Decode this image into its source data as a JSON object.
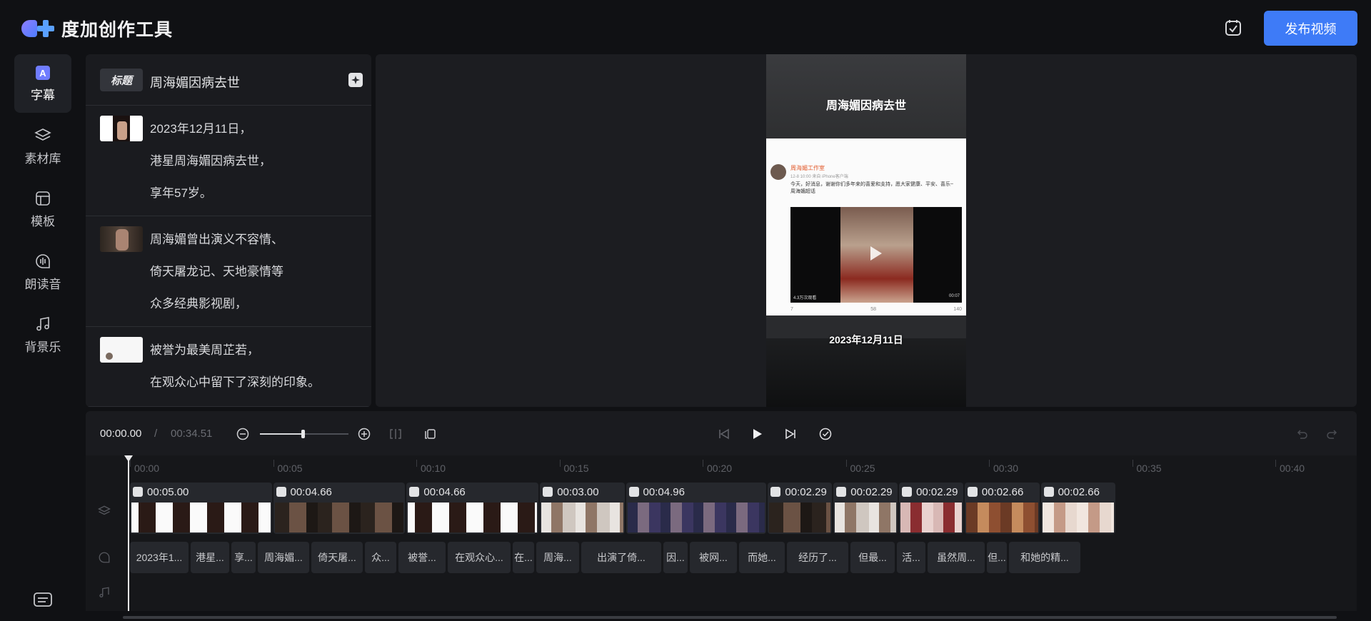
{
  "app": {
    "name": "度加创作工具"
  },
  "header": {
    "publish_label": "发布视频"
  },
  "rail": {
    "items": [
      {
        "label": "字幕",
        "icon": "subtitle-a-icon",
        "active": true
      },
      {
        "label": "素材库",
        "icon": "layers-icon",
        "active": false
      },
      {
        "label": "模板",
        "icon": "template-icon",
        "active": false
      },
      {
        "label": "朗读音",
        "icon": "voice-icon",
        "active": false
      },
      {
        "label": "背景乐",
        "icon": "music-note-icon",
        "active": false
      }
    ]
  },
  "subtitles": {
    "title_tag": "标题",
    "title_text": "周海媚因病去世",
    "segments": [
      {
        "lines": [
          "2023年12月11日，",
          "港星周海媚因病去世，",
          "享年57岁。"
        ]
      },
      {
        "lines": [
          "周海媚曾出演义不容情、",
          "倚天屠龙记、天地豪情等",
          "众多经典影视剧，"
        ]
      },
      {
        "lines": [
          "被誉为最美周芷若，",
          "在观众心中留下了深刻的印象。"
        ]
      }
    ]
  },
  "preview": {
    "caption_top": "周海媚因病去世",
    "caption_bottom": "2023年12月11日",
    "weibo": {
      "name": "周海媚工作室",
      "meta": "12-8 10:00 来自 iPhone客户端",
      "body": "今天，好消息，谢谢你们多年来的喜爱和支持，愿大家健康、平安、喜乐~ 周海媚超话",
      "views": "4.3万次观看",
      "duration": "00:07",
      "repost": "7",
      "comments": "58",
      "likes": "140"
    }
  },
  "controls": {
    "current_time": "00:00.00",
    "separator": "/",
    "total_time": "00:34.51",
    "zoom_level": 0.49
  },
  "ruler": [
    "00:00",
    "00:05",
    "00:10",
    "00:15",
    "00:20",
    "00:25",
    "00:30",
    "00:35",
    "00:40"
  ],
  "clips": [
    {
      "duration": "00:05.00",
      "theme": "doc"
    },
    {
      "duration": "00:04.66",
      "theme": "dark"
    },
    {
      "duration": "00:04.66",
      "theme": "doc"
    },
    {
      "duration": "00:03.00",
      "theme": "light"
    },
    {
      "duration": "00:04.96",
      "theme": "purple"
    },
    {
      "duration": "00:02.29",
      "theme": "dark"
    },
    {
      "duration": "00:02.29",
      "theme": "light"
    },
    {
      "duration": "00:02.29",
      "theme": "pink"
    },
    {
      "duration": "00:02.66",
      "theme": "warm"
    },
    {
      "duration": "00:02.66",
      "theme": "bright"
    }
  ],
  "subtitle_track": [
    "2023年1...",
    "港星...",
    "享...",
    "周海媚...",
    "倚天屠...",
    "众...",
    "被誉...",
    "在观众心...",
    "在...",
    "周海...",
    "出演了倚...",
    "因...",
    "被网...",
    "而她...",
    "经历了...",
    "但最...",
    "活...",
    "虽然周...",
    "但...",
    "和她的精..."
  ],
  "colors": {
    "accent": "#3e7bf7",
    "background": "#101114",
    "panel": "#1a1b1f"
  }
}
